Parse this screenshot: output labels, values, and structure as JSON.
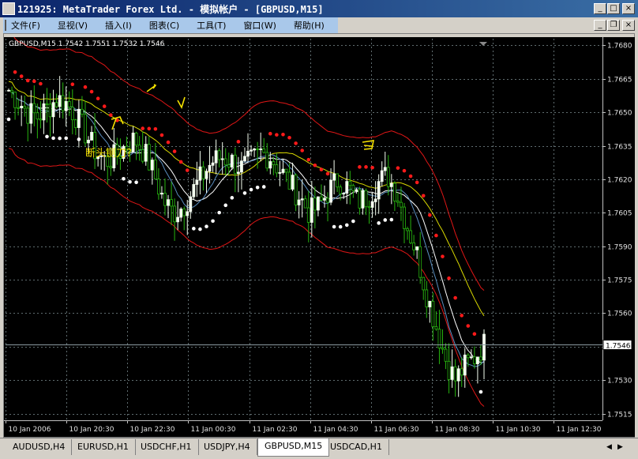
{
  "window": {
    "title": "121925: MetaTrader   Forex Ltd. - 模拟帐户 - [GBPUSD,M15]",
    "controls": [
      "_",
      "□",
      "×"
    ],
    "doc_controls": [
      "_",
      "❐",
      "×"
    ]
  },
  "menu": {
    "items": [
      "文件(F)",
      "显视(V)",
      "插入(I)",
      "图表(C)",
      "工具(T)",
      "窗口(W)",
      "帮助(H)"
    ]
  },
  "chart_info": {
    "header": "GBPUSD,M15  1.7542 1.7551 1.7532 1.7546",
    "annotation": "断头铡刀?",
    "current_price": "1.7546"
  },
  "chart_data": {
    "type": "candlestick",
    "symbol": "GBPUSD",
    "timeframe": "M15",
    "ohlc_current": {
      "open": 1.7542,
      "high": 1.7551,
      "low": 1.7532,
      "close": 1.7546
    },
    "ylim": [
      1.7512,
      1.7683
    ],
    "y_ticks": [
      "1.7680",
      "1.7665",
      "1.7650",
      "1.7635",
      "1.7620",
      "1.7605",
      "1.7590",
      "1.7575",
      "1.7560",
      "1.7545",
      "1.7530",
      "1.7515"
    ],
    "x_ticks": [
      "10 Jan 2006",
      "10 Jan 20:30",
      "10 Jan 22:30",
      "11 Jan 00:30",
      "11 Jan 02:30",
      "11 Jan 04:30",
      "11 Jan 06:30",
      "11 Jan 08:30",
      "11 Jan 10:30",
      "11 Jan 12:30"
    ],
    "close_path": [
      1.766,
      1.7655,
      1.765,
      1.7648,
      1.7652,
      1.7656,
      1.7654,
      1.7648,
      1.764,
      1.7632,
      1.7628,
      1.763,
      1.7635,
      1.7638,
      1.7632,
      1.7622,
      1.761,
      1.7605,
      1.7608,
      1.7615,
      1.7622,
      1.7628,
      1.763,
      1.7628,
      1.7625,
      1.7628,
      1.7632,
      1.763,
      1.7624,
      1.7618,
      1.7612,
      1.7605,
      1.7608,
      1.7615,
      1.762,
      1.7616,
      1.761,
      1.7612,
      1.7618,
      1.7622,
      1.7614,
      1.76,
      1.7588,
      1.757,
      1.7555,
      1.754,
      1.753,
      1.7536,
      1.754,
      1.7546
    ],
    "colors": {
      "background": "#000000",
      "grid": "#5f6c6f",
      "candle_up": "#f5fff0",
      "candle_down": "#27b50f",
      "bands": "#e01616",
      "ma_yellow": "#d8d800",
      "ma_white": "#ffffff",
      "ma_blue": "#5a8ec0",
      "dots_red": "#ff1a1a",
      "dots_white": "#ffffff",
      "annotation": "#f5e100"
    }
  },
  "tabs": {
    "items": [
      "AUDUSD,H4",
      "EURUSD,H1",
      "USDCHF,H1",
      "USDJPY,H4",
      "GBPUSD,M15",
      "USDCAD,H1"
    ],
    "active": 4
  }
}
